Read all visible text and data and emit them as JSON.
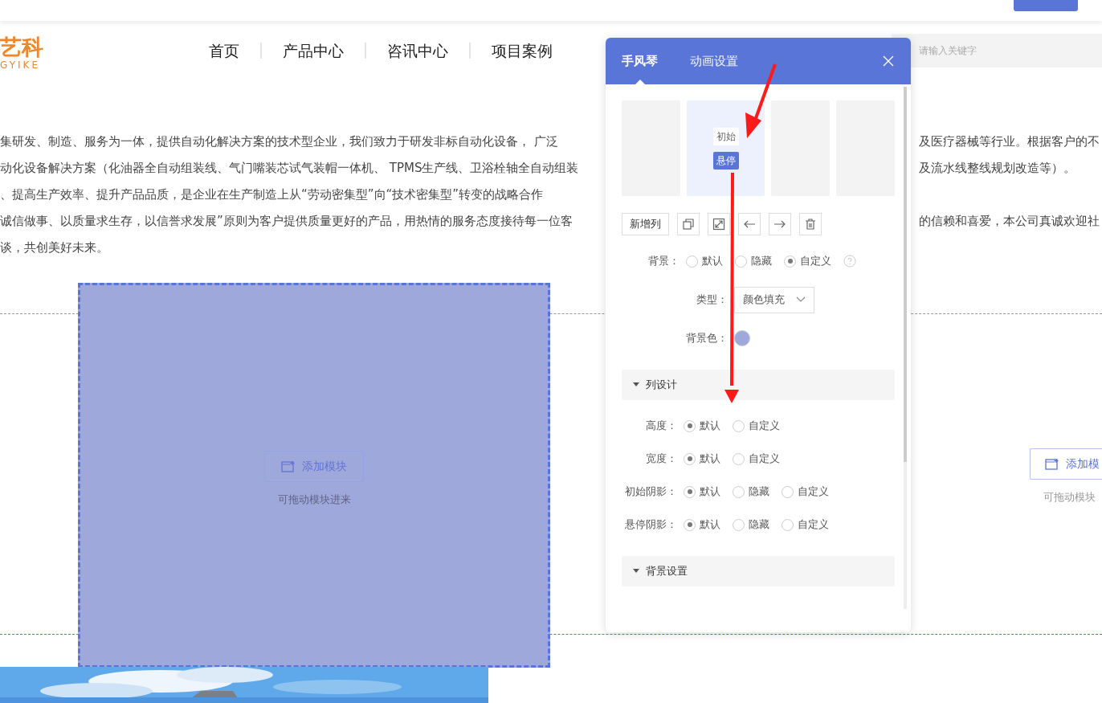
{
  "header": {
    "logo": {
      "text": "艺科",
      "subtext": "GYIKE"
    },
    "nav": [
      {
        "label": "首页"
      },
      {
        "label": "产品中心"
      },
      {
        "label": "咨讯中心"
      },
      {
        "label": "项目案例"
      }
    ],
    "search": {
      "placeholder": "请输入关键字"
    }
  },
  "intro": {
    "lines": [
      {
        "left": "集研发、制造、服务为一体，提供自动化解决方案的技术型企业，我们致力于研发非标自动化设备， 广泛",
        "right": "及医疗器械等行业。根据客户的不"
      },
      {
        "left": "动化设备解决方案（化油器全自动组装线、气门嘴装芯试气装帽一体机、 TPMS生产线、卫浴栓轴全自动组装",
        "right": "及流水线整线规划改造等）。"
      },
      {
        "left": "、提高生产效率、提升产品品质，是企业在生产制造上从“劳动密集型”向“技术密集型”转变的战略合作"
      },
      {
        "left": "诚信做事、以质量求生存，以信誉求发展”原则为客户提供质量更好的产品，用热情的服务态度接待每一位客",
        "right": "的信赖和喜爱，本公司真诚欢迎社"
      },
      {
        "left": "谈，共创美好未来。"
      }
    ]
  },
  "modules": [
    {
      "selected": true,
      "button": "添加模块",
      "hint": "可拖动模块进来"
    },
    {
      "selected": false,
      "button": "添加模",
      "hint": "可拖动模块"
    }
  ],
  "panel": {
    "tabs": [
      {
        "label": "手风琴",
        "selected": true
      },
      {
        "label": "动画设置",
        "selected": false
      }
    ],
    "columns": [
      {
        "selected": false
      },
      {
        "selected": true,
        "states": [
          {
            "label": "初始",
            "selected": false
          },
          {
            "label": "悬停",
            "selected": true
          }
        ]
      },
      {
        "selected": false
      },
      {
        "selected": false
      }
    ],
    "add_column": "新增列",
    "rows": [
      {
        "kind": "radio",
        "label": "背景：",
        "help": true,
        "options": [
          {
            "label": "默认",
            "selected": false
          },
          {
            "label": "隐藏",
            "selected": false
          },
          {
            "label": "自定义",
            "selected": true
          }
        ]
      },
      {
        "kind": "select",
        "label": "类型：",
        "value": "颜色填充"
      },
      {
        "kind": "color",
        "label": "背景色：",
        "color": "#9fa8da"
      },
      {
        "kind": "section",
        "label": "列设计",
        "expanded": true,
        "children": [
          {
            "kind": "radio",
            "label": "高度：",
            "options": [
              {
                "label": "默认",
                "selected": true
              },
              {
                "label": "自定义",
                "selected": false
              }
            ]
          },
          {
            "kind": "radio",
            "label": "宽度：",
            "options": [
              {
                "label": "默认",
                "selected": true
              },
              {
                "label": "自定义",
                "selected": false
              }
            ]
          },
          {
            "kind": "radio",
            "label": "初始阴影：",
            "options": [
              {
                "label": "默认",
                "selected": true
              },
              {
                "label": "隐藏",
                "selected": false
              },
              {
                "label": "自定义",
                "selected": false
              }
            ]
          },
          {
            "kind": "radio",
            "label": "悬停阴影：",
            "options": [
              {
                "label": "默认",
                "selected": true
              },
              {
                "label": "隐藏",
                "selected": false
              },
              {
                "label": "自定义",
                "selected": false
              }
            ]
          }
        ]
      },
      {
        "kind": "section",
        "label": "背景设置",
        "expanded": true
      }
    ]
  }
}
